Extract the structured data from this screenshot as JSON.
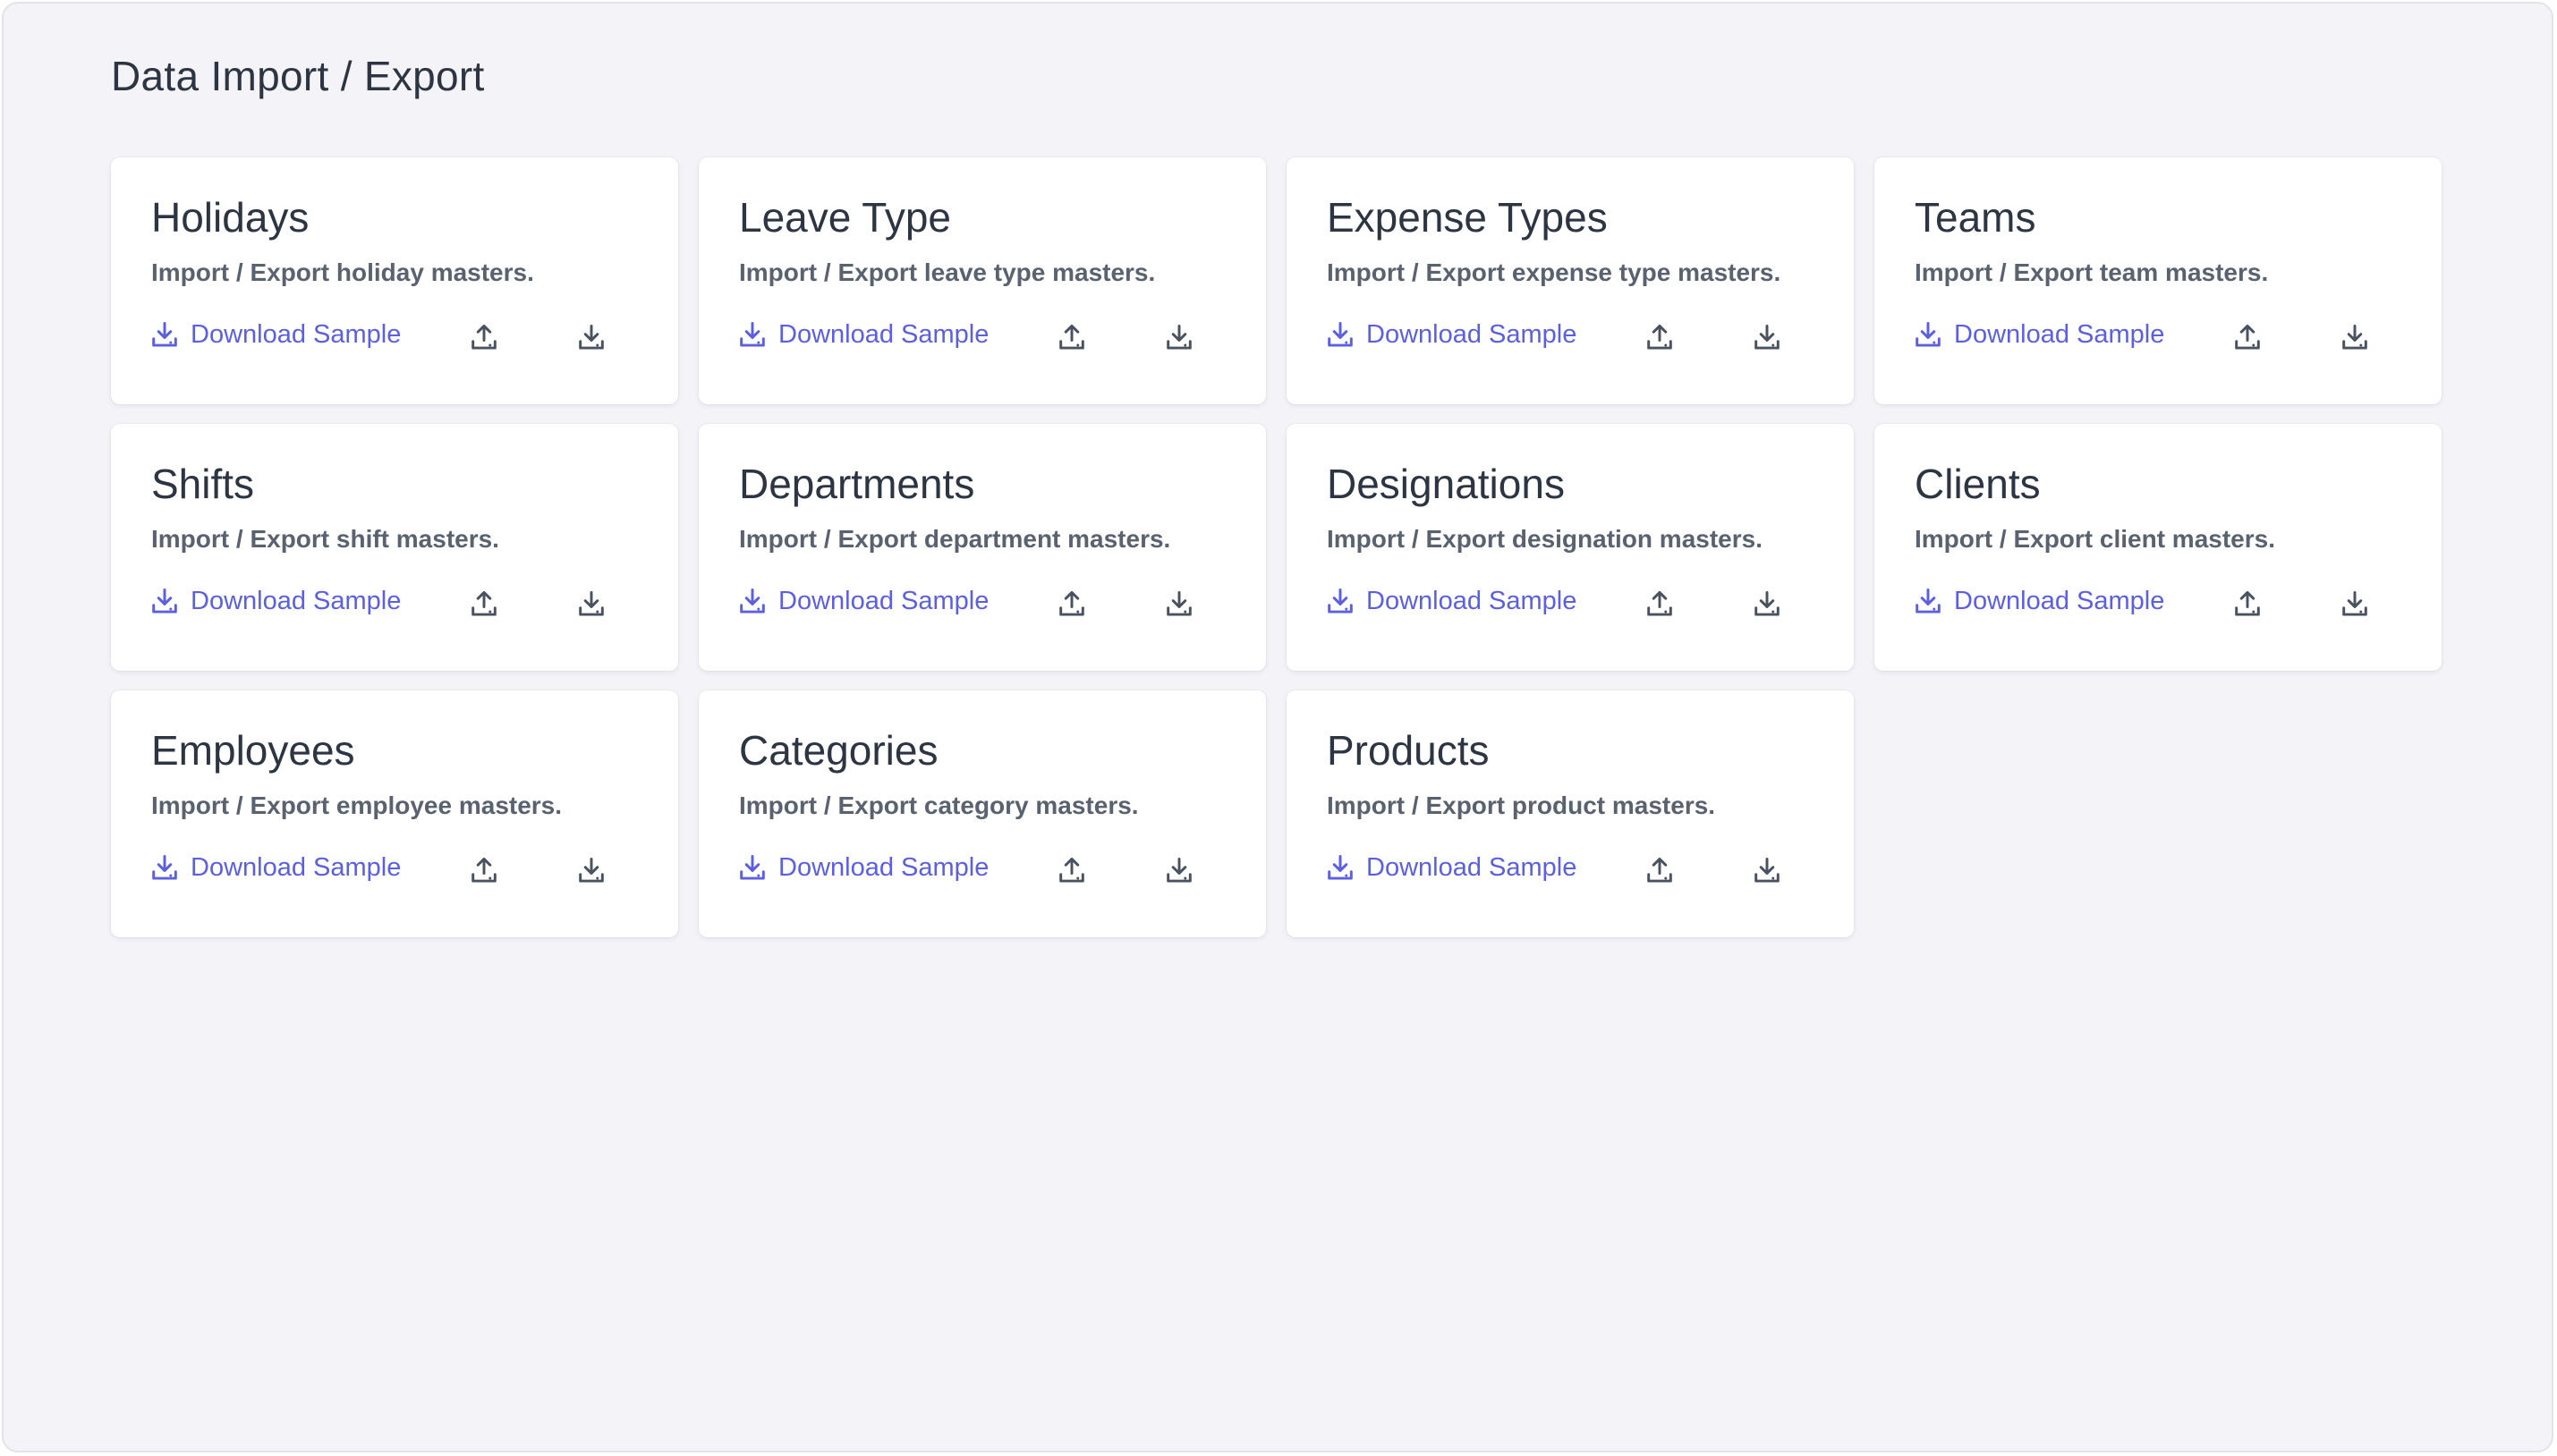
{
  "page": {
    "title": "Data Import / Export"
  },
  "colors": {
    "background": "#f4f4f8",
    "card": "#ffffff",
    "link": "#5b5fe0",
    "icon": "#4a5260",
    "title": "#2d3542",
    "description": "#5a6270"
  },
  "icons": {
    "sample": "download-tray-icon",
    "import": "upload-tray-icon",
    "export": "download-tray-icon"
  },
  "cards": [
    {
      "title": "Holidays",
      "description": "Import / Export holiday masters.",
      "sample_label": "Download Sample"
    },
    {
      "title": "Leave Type",
      "description": "Import / Export leave type masters.",
      "sample_label": "Download Sample"
    },
    {
      "title": "Expense Types",
      "description": "Import / Export expense type masters.",
      "sample_label": "Download Sample"
    },
    {
      "title": "Teams",
      "description": "Import / Export team masters.",
      "sample_label": "Download Sample"
    },
    {
      "title": "Shifts",
      "description": "Import / Export shift masters.",
      "sample_label": "Download Sample"
    },
    {
      "title": "Departments",
      "description": "Import / Export department masters.",
      "sample_label": "Download Sample"
    },
    {
      "title": "Designations",
      "description": "Import / Export designation masters.",
      "sample_label": "Download Sample"
    },
    {
      "title": "Clients",
      "description": "Import / Export client masters.",
      "sample_label": "Download Sample"
    },
    {
      "title": "Employees",
      "description": "Import / Export employee masters.",
      "sample_label": "Download Sample"
    },
    {
      "title": "Categories",
      "description": "Import / Export category masters.",
      "sample_label": "Download Sample"
    },
    {
      "title": "Products",
      "description": "Import / Export product masters.",
      "sample_label": "Download Sample"
    }
  ]
}
